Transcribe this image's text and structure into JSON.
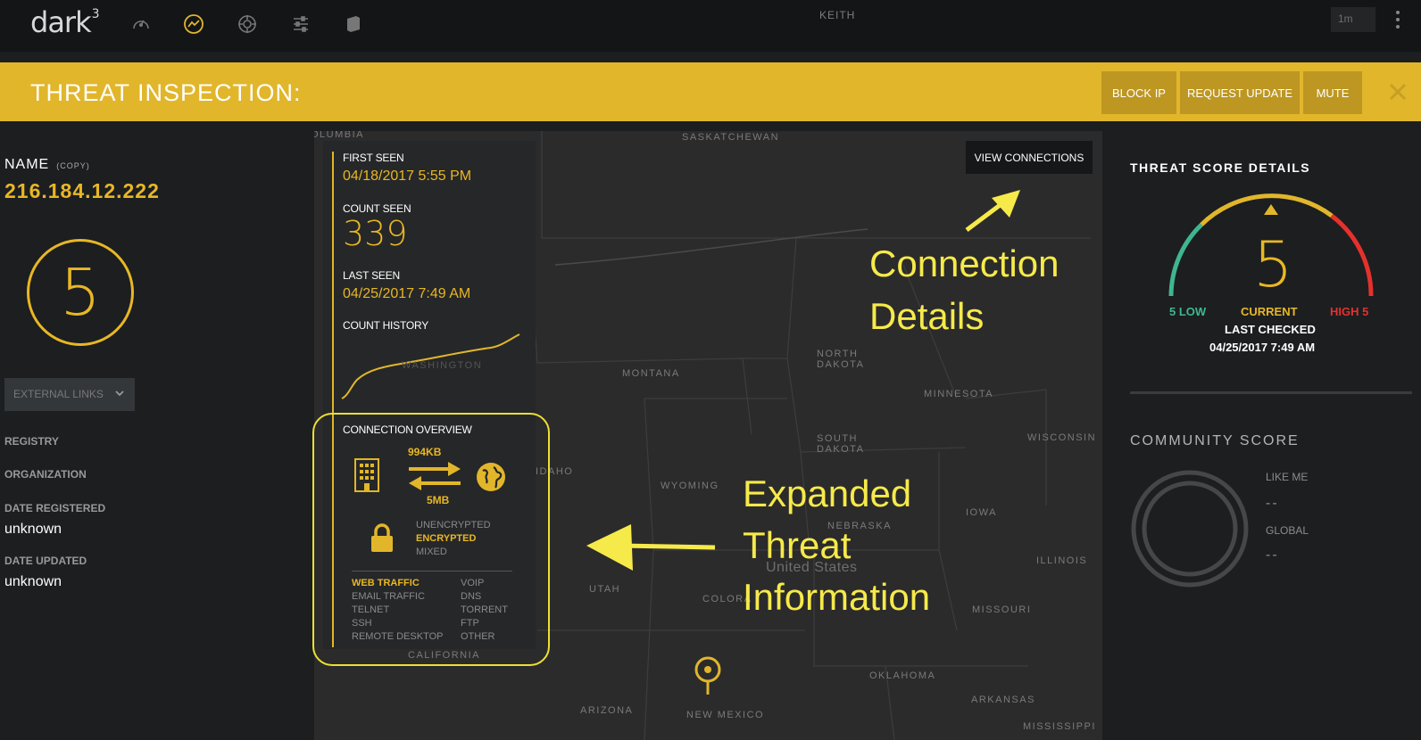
{
  "nav": {
    "logo": "dark",
    "logo_sup": "3",
    "user": "KEITH",
    "time_range": "1m",
    "icons": [
      "speedometer-icon",
      "chart-line-icon",
      "crosshair-icon",
      "sliders-icon",
      "cube-icon"
    ]
  },
  "banner": {
    "title": "THREAT INSPECTION:",
    "buttons": {
      "block_ip": "BLOCK IP",
      "request_update": "REQUEST UPDATE",
      "mute": "MUTE"
    }
  },
  "left": {
    "name_label": "NAME",
    "copy_label": "(COPY)",
    "ip": "216.184.12.222",
    "score": "5",
    "external_links": "EXTERNAL LINKS",
    "registry_label": "REGISTRY",
    "organization_label": "ORGANIZATION",
    "date_registered_label": "DATE REGISTERED",
    "date_registered": "unknown",
    "date_updated_label": "DATE UPDATED",
    "date_updated": "unknown"
  },
  "card": {
    "first_seen_label": "FIRST SEEN",
    "first_seen": "04/18/2017 5:55 PM",
    "count_seen_label": "COUNT SEEN",
    "count_seen": "339",
    "last_seen_label": "LAST SEEN",
    "last_seen": "04/25/2017 7:49 AM",
    "count_history_label": "COUNT HISTORY",
    "connection_overview_label": "CONNECTION OVERVIEW",
    "upload": "994KB",
    "download": "5MB",
    "encryption": [
      "UNENCRYPTED",
      "ENCRYPTED",
      "MIXED"
    ],
    "traffic_left": [
      "WEB TRAFFIC",
      "EMAIL TRAFFIC",
      "TELNET",
      "SSH",
      "REMOTE DESKTOP"
    ],
    "traffic_right": [
      "VOIP",
      "DNS",
      "TORRENT",
      "FTP",
      "OTHER"
    ]
  },
  "map": {
    "view_connections": "VIEW CONNECTIONS",
    "labels": {
      "saskatchewan": "SASKATCHEWAN",
      "columbia": "OLUMBIA",
      "montana": "MONTANA",
      "north_dakota": "NORTH\nDAKOTA",
      "minnesota": "MINNESOTA",
      "south_dakota": "SOUTH\nDAKOTA",
      "wisconsin": "WISCONSIN",
      "wyoming": "WYOMING",
      "idaho": "IDAHO",
      "nebraska": "NEBRASKA",
      "iowa": "IOWA",
      "united_states": "United States",
      "illinois": "ILLINOIS",
      "utah": "UTAH",
      "colorado": "COLORA",
      "missouri": "MISSOURI",
      "california": "CALIFORNIA",
      "oklahoma": "OKLAHOMA",
      "arkansas": "ARKANSAS",
      "arizona": "ARIZONA",
      "new_mexico": "NEW MEXICO",
      "mississippi": "MISSISSIPPI",
      "washington": "WASHINGTON"
    }
  },
  "annotations": {
    "connection_line1": "Connection",
    "connection_line2": "Details",
    "expanded_line1": "Expanded",
    "expanded_line2": "Threat",
    "expanded_line3": "Information",
    "color": "#f6ea4a"
  },
  "right": {
    "threat_score_title": "THREAT SCORE DETAILS",
    "score": "5",
    "low": "5 LOW",
    "current": "CURRENT",
    "high": "HIGH 5",
    "last_checked_label": "LAST CHECKED",
    "last_checked": "04/25/2017 7:49 AM",
    "community_title": "COMMUNITY SCORE",
    "like_me_label": "LIKE ME",
    "like_me_value": "--",
    "global_label": "GLOBAL",
    "global_value": "--"
  },
  "colors": {
    "accent": "#e1b62b",
    "accent_text": "#e8b725",
    "low": "#3fb68f",
    "high": "#e5312c",
    "background": "#1c1e20"
  }
}
